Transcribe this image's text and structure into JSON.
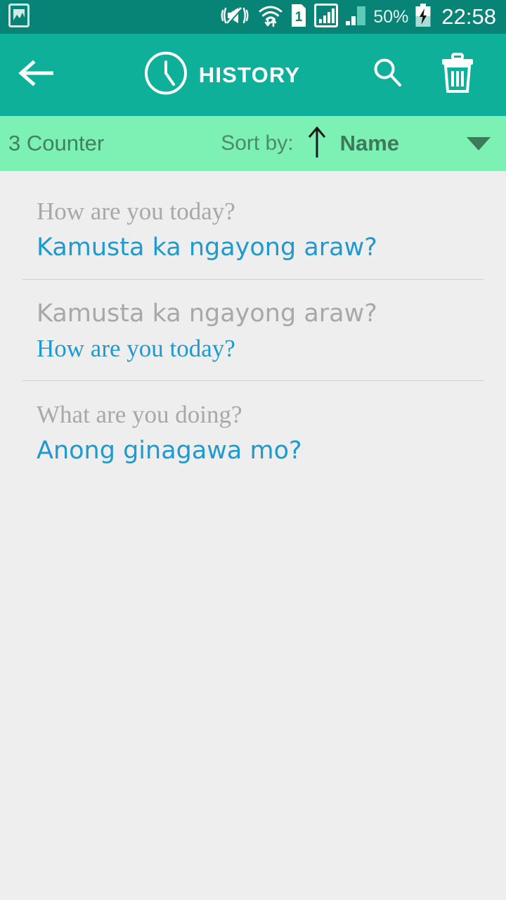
{
  "statusbar": {
    "time": "22:58",
    "battery_percent": "50%",
    "sim_label": "1",
    "icons": [
      "gallery-icon",
      "vibrate-mute-icon",
      "wifi-transfer-icon",
      "sim1-icon",
      "signal-bars-icon",
      "signal-bars-secondary-icon",
      "battery-charging-icon"
    ]
  },
  "appbar": {
    "title": "HISTORY",
    "back_icon": "back-arrow-icon",
    "clock_icon": "clock-icon",
    "search_icon": "search-icon",
    "delete_icon": "trash-icon",
    "background_color": "#0fb09a"
  },
  "sortbar": {
    "counter_text": "3 Counter",
    "sort_by_label": "Sort by:",
    "sort_value": "Name",
    "sort_direction_icon": "arrow-up-icon",
    "dropdown_icon": "chevron-down-icon",
    "background_color": "#7df0b4"
  },
  "history": {
    "items": [
      {
        "source": "How are you today?",
        "target": "Kamusta ka ngayong araw?",
        "source_style": "serif",
        "target_style": "round"
      },
      {
        "source": "Kamusta ka ngayong araw?",
        "target": "How are you today?",
        "source_style": "round",
        "target_style": "serif"
      },
      {
        "source": "What are you doing?",
        "target": "Anong ginagawa mo?",
        "source_style": "serif",
        "target_style": "round"
      }
    ]
  },
  "colors": {
    "accent": "#0fb09a",
    "status_bar": "#088476",
    "sort_bar": "#7df0b4",
    "translation_text": "#1e9ad1",
    "source_text": "#a8a8a8",
    "page_background": "#eeeeee"
  }
}
